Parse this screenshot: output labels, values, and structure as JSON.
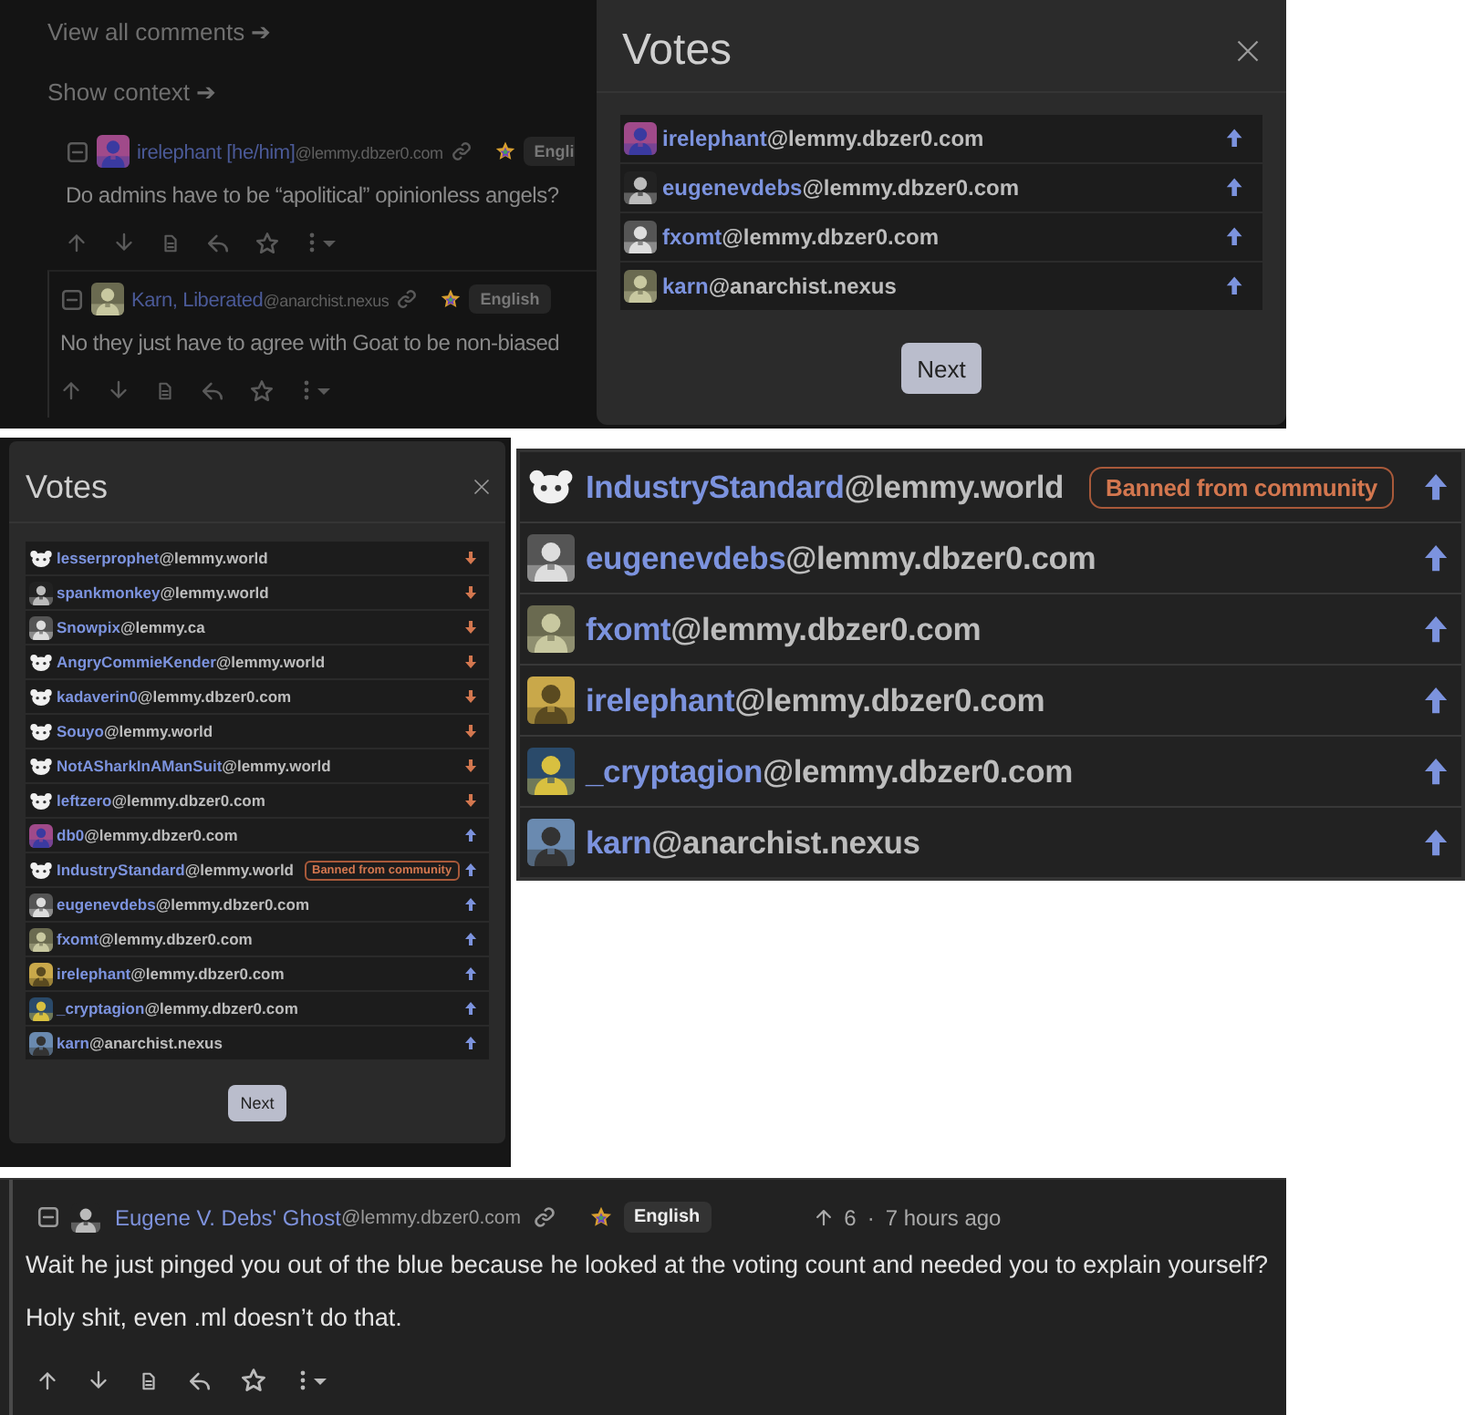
{
  "background_thread": {
    "links": [
      "View all comments ➔",
      "Show context ➔"
    ],
    "comments": [
      {
        "author": "irelephant [he/him]",
        "instance": "@lemmy.dbzer0.com",
        "language": "Engli",
        "body": "Do admins have to be “apolitical” opinionless angels?",
        "nested": false
      },
      {
        "author": "Karn, Liberated",
        "instance": "@anarchist.nexus",
        "language": "English",
        "body": "No they just have to agree with Goat to be non-biased",
        "nested": true
      }
    ]
  },
  "votes_dialog_top": {
    "title": "Votes",
    "button": "Next",
    "voters": [
      {
        "name": "irelephant",
        "instance": "@lemmy.dbzer0.com",
        "upvoted": true
      },
      {
        "name": "eugenevdebs",
        "instance": "@lemmy.dbzer0.com",
        "upvoted": true
      },
      {
        "name": "fxomt",
        "instance": "@lemmy.dbzer0.com",
        "upvoted": true
      },
      {
        "name": "karn",
        "instance": "@anarchist.nexus",
        "upvoted": true
      }
    ]
  },
  "votes_dialog_left": {
    "title": "Votes",
    "button": "Next",
    "voters": [
      {
        "name": "lesserprophet",
        "instance": "@lemmy.world",
        "upvoted": false,
        "avatar": {
          "kind": "default"
        }
      },
      {
        "name": "spankmonkey",
        "instance": "@lemmy.world",
        "upvoted": false
      },
      {
        "name": "Snowpix",
        "instance": "@lemmy.ca",
        "upvoted": false
      },
      {
        "name": "AngryCommieKender",
        "instance": "@lemmy.world",
        "upvoted": false,
        "avatar": {
          "kind": "default"
        }
      },
      {
        "name": "kadaverin0",
        "instance": "@lemmy.dbzer0.com",
        "upvoted": false,
        "avatar": {
          "kind": "default"
        }
      },
      {
        "name": "Souyo",
        "instance": "@lemmy.world",
        "upvoted": false,
        "avatar": {
          "kind": "default"
        }
      },
      {
        "name": "NotASharkInAManSuit",
        "instance": "@lemmy.world",
        "upvoted": false,
        "avatar": {
          "kind": "default"
        }
      },
      {
        "name": "leftzero",
        "instance": "@lemmy.dbzer0.com",
        "upvoted": false,
        "avatar": {
          "kind": "default"
        }
      },
      {
        "name": "db0",
        "instance": "@lemmy.dbzer0.com",
        "upvoted": true
      },
      {
        "name": "IndustryStandard",
        "instance": "@lemmy.world",
        "upvoted": true,
        "avatar": {
          "kind": "default"
        },
        "badge": "Banned from community"
      },
      {
        "name": "eugenevdebs",
        "instance": "@lemmy.dbzer0.com",
        "upvoted": true
      },
      {
        "name": "fxomt",
        "instance": "@lemmy.dbzer0.com",
        "upvoted": true
      },
      {
        "name": "irelephant",
        "instance": "@lemmy.dbzer0.com",
        "upvoted": true
      },
      {
        "name": "_cryptagion",
        "instance": "@lemmy.dbzer0.com",
        "upvoted": true
      },
      {
        "name": "karn",
        "instance": "@anarchist.nexus",
        "upvoted": true
      }
    ]
  },
  "voters_zoomed": {
    "voters": [
      {
        "name": "IndustryStandard",
        "instance": "@lemmy.world",
        "upvoted": true,
        "avatar": {
          "kind": "default"
        },
        "badge": "Banned from community"
      },
      {
        "name": "eugenevdebs",
        "instance": "@lemmy.dbzer0.com",
        "upvoted": true
      },
      {
        "name": "fxomt",
        "instance": "@lemmy.dbzer0.com",
        "upvoted": true
      },
      {
        "name": "irelephant",
        "instance": "@lemmy.dbzer0.com",
        "upvoted": true
      },
      {
        "name": "_cryptagion",
        "instance": "@lemmy.dbzer0.com",
        "upvoted": true
      },
      {
        "name": "karn",
        "instance": "@anarchist.nexus",
        "upvoted": true
      }
    ]
  },
  "comment": {
    "author": "Eugene V. Debs' Ghost",
    "instance": "@lemmy.dbzer0.com",
    "language": "English",
    "score": "6",
    "separator": "·",
    "time": "7 hours ago",
    "paragraphs": [
      "Wait he just pinged you out of the blue because he looked at the voting count and needed you to explain yourself?",
      "Holy shit, even .ml doesn’t do that."
    ]
  }
}
